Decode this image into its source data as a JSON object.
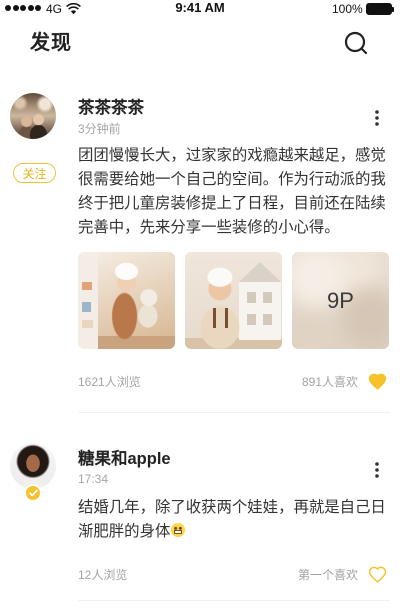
{
  "status_bar": {
    "signal_bars": 5,
    "network": "4G",
    "time": "9:41 AM",
    "battery": "100%",
    "wifi_icon": "wifi-icon",
    "battery_icon": "battery-icon"
  },
  "header": {
    "title": "发现",
    "search_icon": "search-icon"
  },
  "posts": [
    {
      "username": "茶茶茶茶",
      "time": "3分钟前",
      "follow_label": "关注",
      "verified": false,
      "body_lines": [
        "团团慢慢长大，过家家的戏瘾越来越足，感觉",
        "很需要给她一个自己的空间。作为行动派的我",
        "终于把儿童房装修提上了日程，目前还在陆续",
        "完善中，先来分享一些装修的小心得。"
      ],
      "photo_count_label": "9P",
      "views": "1621人浏览",
      "likes": "891人喜欢",
      "liked": true,
      "more_icon": "more-vertical-icon",
      "like_icon": "heart-icon"
    },
    {
      "username": "糖果和apple",
      "time": "17:34",
      "verified": true,
      "body_lines": [
        "结婚几年，除了收获两个娃娃，再就是自己日",
        "渐肥胖的身体"
      ],
      "body_emoji": "grin-emoji-icon",
      "views": "12人浏览",
      "likes": "第一个喜欢",
      "liked": false,
      "more_icon": "more-vertical-icon",
      "like_icon": "heart-icon"
    }
  ],
  "colors": {
    "accent": "#F5C22B",
    "text": "#222222",
    "muted": "#A3A3A3"
  }
}
